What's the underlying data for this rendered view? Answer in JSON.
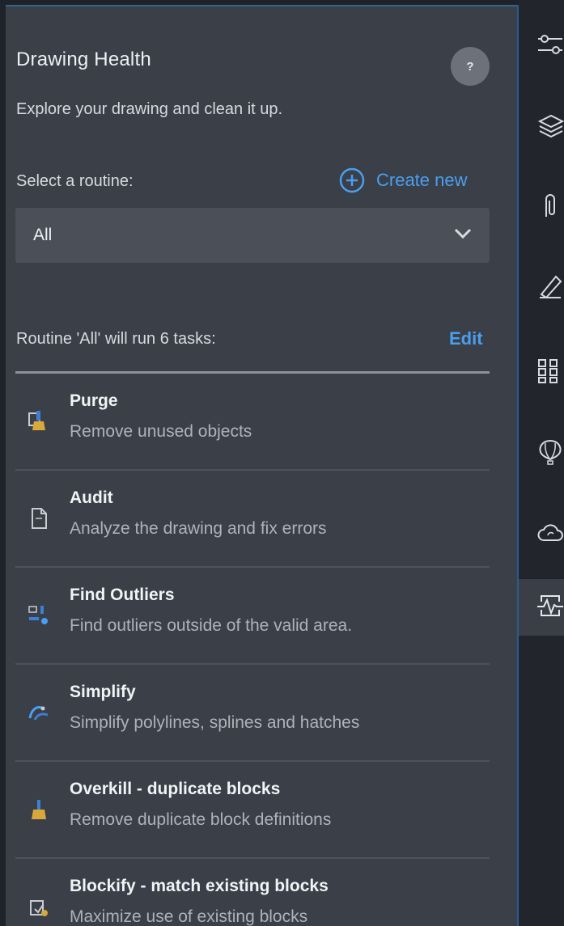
{
  "panel": {
    "title": "Drawing Health",
    "help_label": "?",
    "subtitle": "Explore your drawing and clean it up.",
    "select_label": "Select a routine:",
    "create_new_label": "Create new",
    "routine_dropdown": {
      "selected": "All"
    },
    "summary": "Routine 'All' will run 6 tasks:",
    "edit_label": "Edit"
  },
  "tasks": [
    {
      "name": "Purge",
      "description": "Remove unused objects",
      "icon": "purge-icon"
    },
    {
      "name": "Audit",
      "description": "Analyze the drawing and fix errors",
      "icon": "audit-icon"
    },
    {
      "name": "Find Outliers",
      "description": "Find outliers outside of the valid area.",
      "icon": "find-outliers-icon"
    },
    {
      "name": "Simplify",
      "description": "Simplify polylines, splines and hatches",
      "icon": "simplify-icon"
    },
    {
      "name": "Overkill - duplicate blocks",
      "description": "Remove duplicate block definitions",
      "icon": "overkill-icon"
    },
    {
      "name": "Blockify - match existing blocks",
      "description": "Maximize use of existing blocks",
      "icon": "blockify-icon"
    }
  ],
  "toolbar": {
    "items": [
      {
        "icon": "properties-icon"
      },
      {
        "icon": "layers-icon"
      },
      {
        "icon": "attach-icon"
      },
      {
        "icon": "markup-icon"
      },
      {
        "icon": "blocks-icon"
      },
      {
        "icon": "xref-balloon-icon"
      },
      {
        "icon": "cloud-sync-icon"
      },
      {
        "icon": "drawing-health-icon",
        "active": true
      }
    ]
  },
  "colors": {
    "accent": "#4a9ff0",
    "panel_bg": "#3a3f48",
    "toolbar_bg": "#22252b"
  }
}
